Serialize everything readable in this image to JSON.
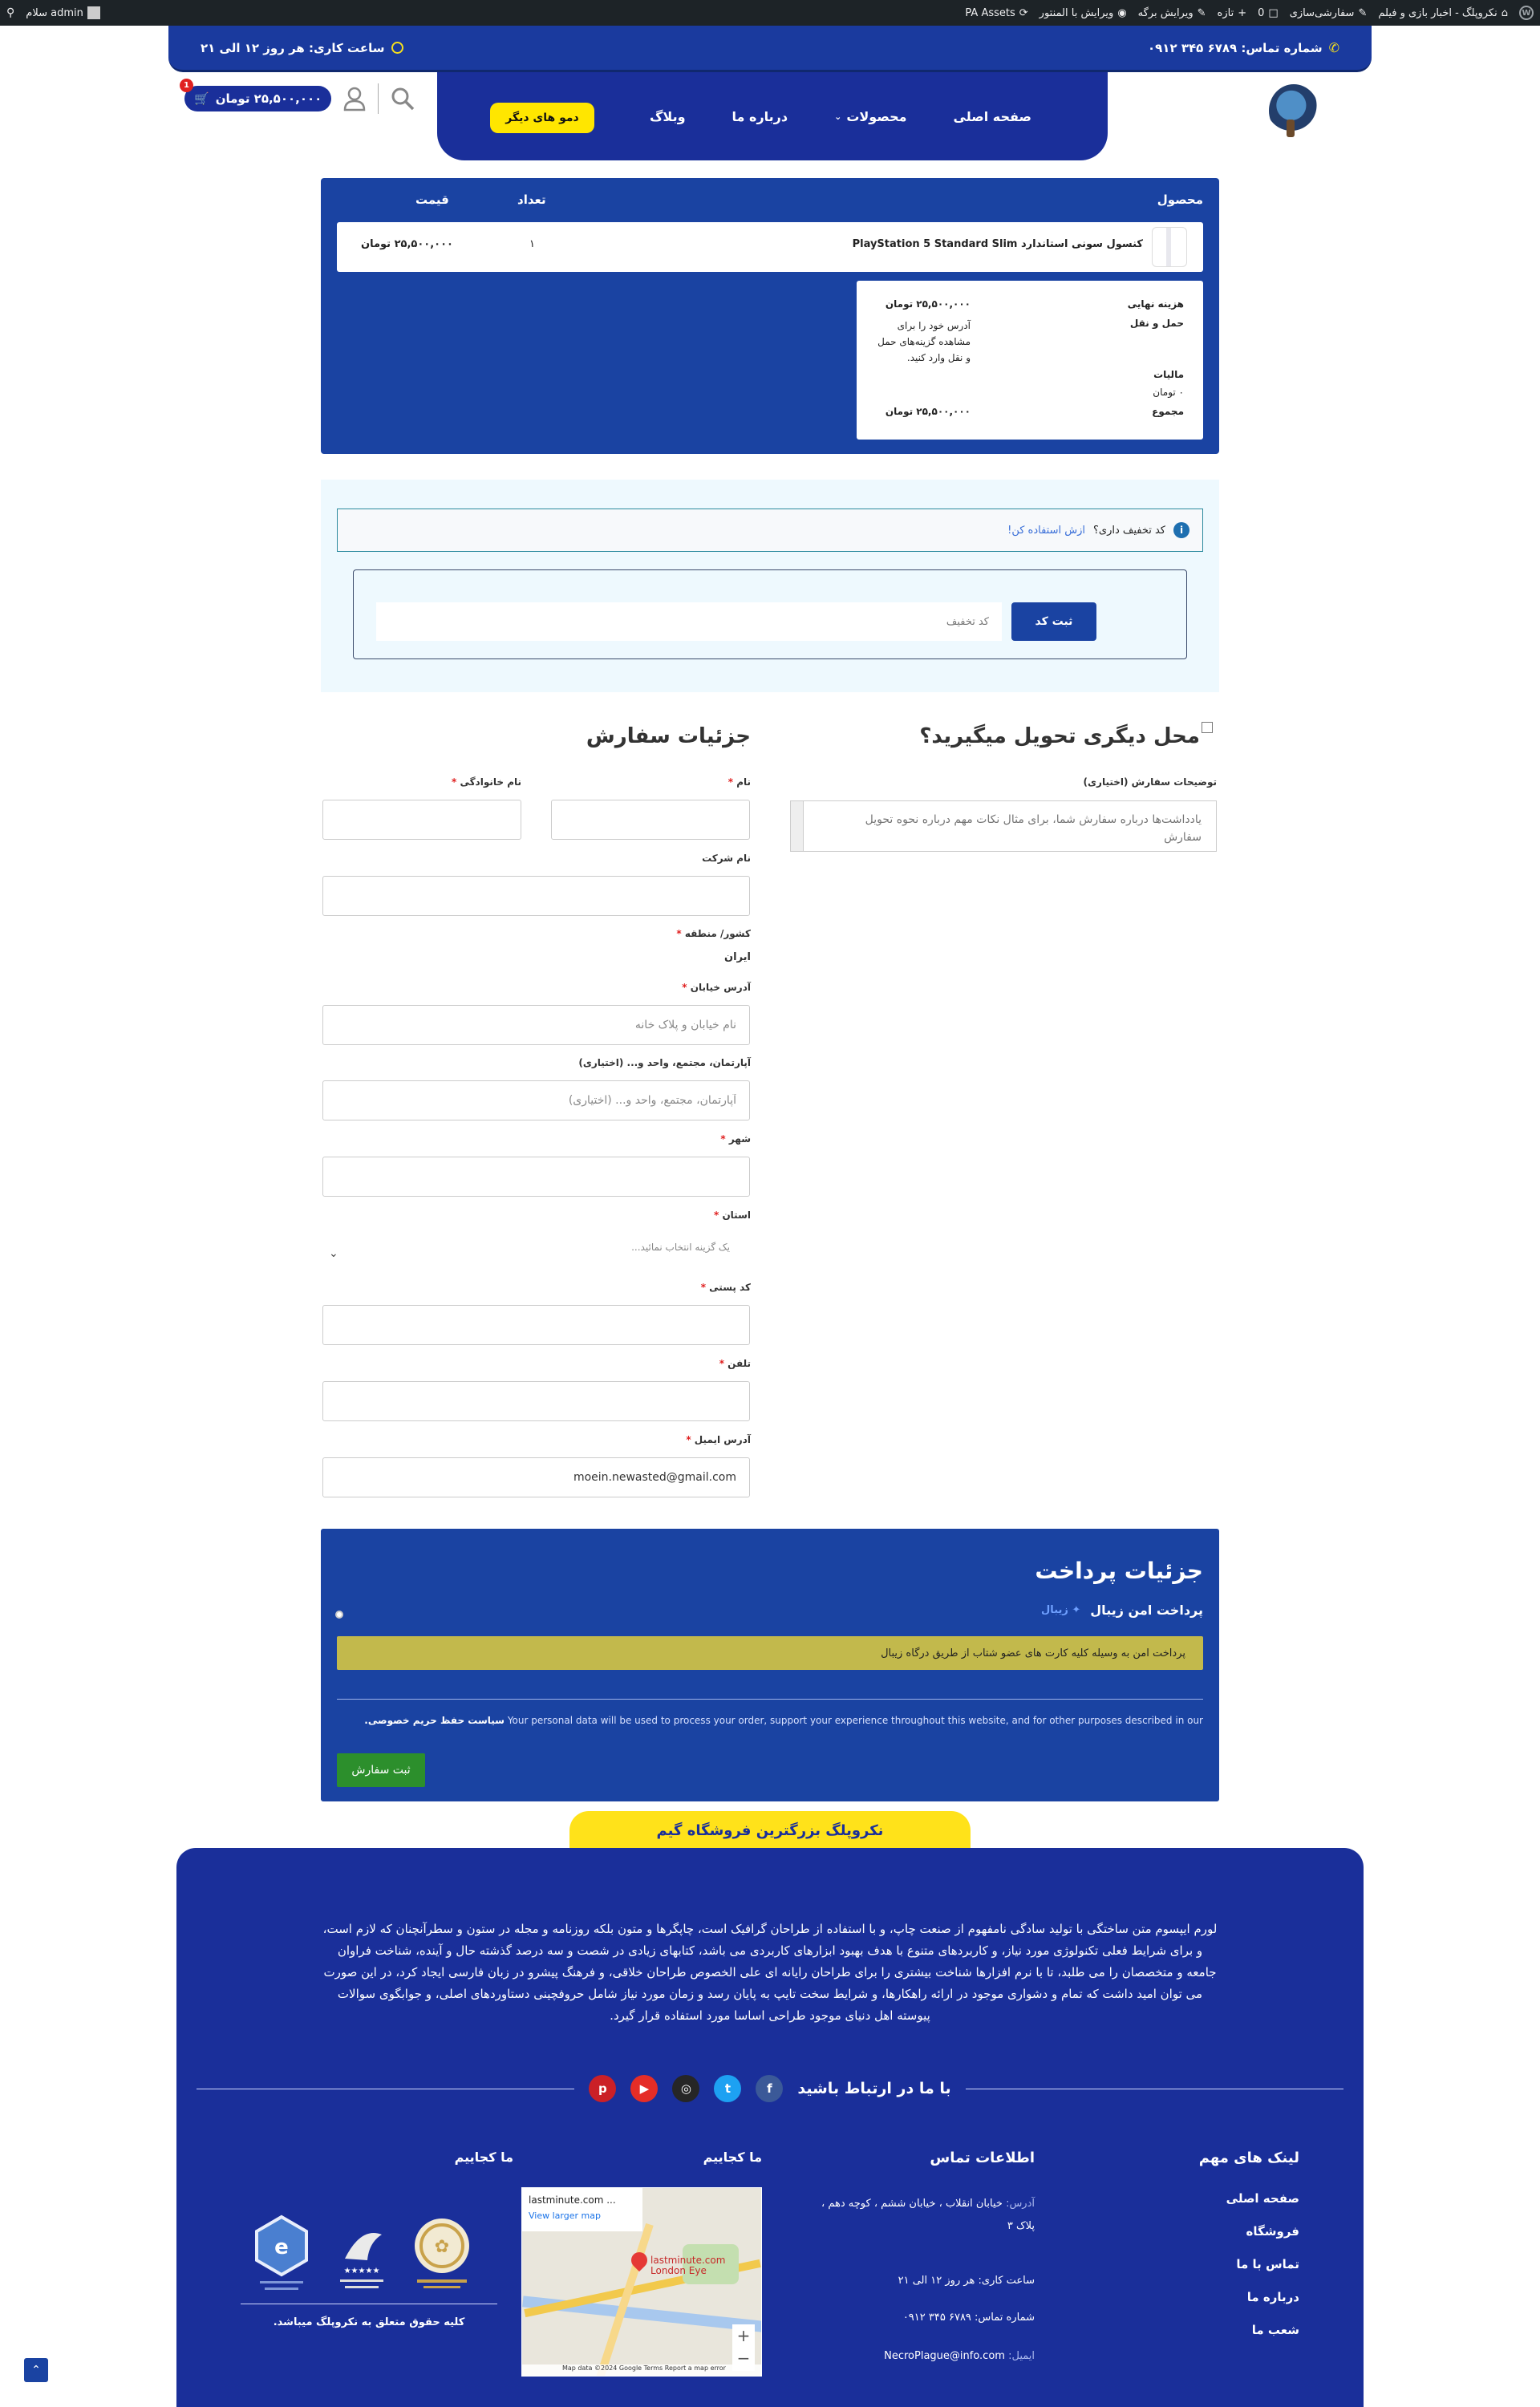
{
  "adminbar": {
    "site_name": "نکروپلگ - اخبار بازی و فیلم",
    "customize": "سفارشی‌سازی",
    "comments_count": "0",
    "new_label": "تازه",
    "edit_page": "ویرایش برگه",
    "edit_elementor": "ویرایش با المنتور",
    "pa_assets": "PA Assets",
    "greeting": "سلام admin"
  },
  "topbar": {
    "phone": "شماره تماس: ۶۷۸۹ ۳۴۵ ۰۹۱۲",
    "hours": "ساعت کاری: هر روز ۱۲ الی ۲۱"
  },
  "nav": {
    "home": "صفحه اصلی",
    "products": "محصولات",
    "about": "درباره ما",
    "blog": "وبلاگ",
    "demo_button": "دمو های دیگر"
  },
  "header_cart": {
    "total": "۲۵,۵۰۰,۰۰۰ تومان",
    "count": "1"
  },
  "cart": {
    "headers": {
      "product": "محصول",
      "quantity": "تعداد",
      "price": "قیمت"
    },
    "item": {
      "name": "کنسول سونی استاندارد PlayStation 5 Standard Slim",
      "quantity": "۱",
      "price": "۲۵,۵۰۰,۰۰۰ تومان"
    },
    "totals": {
      "final_label": "هزینه نهایی",
      "final_value": "۲۵,۵۰۰,۰۰۰ تومان",
      "shipping_label": "حمل و نقل",
      "shipping_value": "آدرس خود را برای مشاهده گزینه‌های حمل و نقل وارد کنید.",
      "tax_label": "مالیات",
      "tax_value": "۰ تومان",
      "sum_label": "مجموع",
      "sum_value": "۲۵,۵۰۰,۰۰۰ تومان"
    }
  },
  "coupon": {
    "question": "کد تخفیف داری؟",
    "link": "ازش استفاده کن!",
    "placeholder": "کد تخفیف",
    "button": "ثبت کد"
  },
  "billing": {
    "title": "جزئیات سفارش",
    "first_name_label": "نام",
    "last_name_label": "نام خانوادگی",
    "company_label": "نام شرکت",
    "country_label": "کشور/ منطقه",
    "country_value": "ایران",
    "street_label": "آدرس خیابان",
    "street_placeholder": "نام خیابان و پلاک خانه",
    "apartment_label": "آپارتمان، مجتمع، واحد و... (اختیاری)",
    "apartment_placeholder": "آپارتمان، مجتمع، واحد و... (اختیاری)",
    "city_label": "شهر",
    "state_label": "استان",
    "state_placeholder": "یک گزینه انتخاب نمائید...",
    "postcode_label": "کد پستی",
    "phone_label": "تلفن",
    "email_label": "آدرس ایمیل",
    "email_value": "moein.newasted@gmail.com",
    "required_mark": "*"
  },
  "shipping": {
    "title": "محل دیگری تحویل میگیرید؟",
    "notes_label": "توضیحات سفارش (اختیاری)",
    "notes_placeholder": "یادداشت‌ها درباره سفارش شما، برای مثال نکات مهم درباره نحوه تحویل سفارش"
  },
  "payment": {
    "title": "جزئیات پرداخت",
    "method": "پرداخت امن زیبال",
    "gateway_name": "زیبال",
    "description": "پرداخت امن به وسیله کلیه کارت های عضو شتاب از طریق درگاه زیبال",
    "privacy_text": "Your personal data will be used to process your order, support your experience throughout this website, and for other purposes described in our",
    "privacy_link": "سیاست حفظ حریم خصوصی.",
    "order_button": "ثبت سفارش"
  },
  "footer": {
    "tab": "نکروپلگ بزرگترین فروشگاه گیم",
    "text": "لورم ایپسوم متن ساختگی با تولید سادگی نامفهوم از صنعت چاپ، و با استفاده از طراحان گرافیک است، چاپگرها و متون بلکه روزنامه و مجله در ستون و سطرآنچنان که لازم است، و برای شرایط فعلی تکنولوژی مورد نیاز، و کاربردهای متنوع با هدف بهبود ابزارهای کاربردی می باشد، کتابهای زیادی در شصت و سه درصد گذشته حال و آینده، شناخت فراوان جامعه و متخصصان را می طلبد، تا با نرم افزارها شناخت بیشتری را برای طراحان رایانه ای علی الخصوص طراحان خلاقی، و فرهنگ پیشرو در زبان فارسی ایجاد کرد، در این صورت می توان امید داشت که تمام و دشواری موجود در ارائه راهکارها، و شرایط سخت تایپ به پایان رسد و زمان مورد نیاز شامل حروفچینی دستاوردهای اصلی، و جوابگوی سوالات پیوسته اهل دنیای موجود طراحی اساسا مورد استفاده قرار گیرد.",
    "contact_title": "با ما در ارتباط باشید",
    "social": [
      "facebook-icon",
      "twitter-icon",
      "instagram-icon",
      "youtube-icon",
      "pinterest-icon"
    ],
    "links_title": "لینک های مهم",
    "links": [
      "صفحه اصلی",
      "فروشگاه",
      "تماس با ما",
      "درباره ما",
      "شعب ما"
    ],
    "info_title": "اطلاعات تماس",
    "address_label": "آدرس:",
    "address": "خیابان انقلاب ، خیابان ششم ، کوچه دهم ، پلاک ۳",
    "hours": "ساعت کاری: هر روز ۱۲ الی ۲۱",
    "phone": "شماره تماس: ۶۷۸۹ ۳۴۵ ۰۹۱۲",
    "email_label": "ایمیل:",
    "email": "NecroPlague@info.com",
    "map_title": "ما کجاییم",
    "map_place": "lastminute.com ...",
    "map_link": "View larger map",
    "map_pin_label": "lastminute.com London Eye",
    "map_credit": "Map data ©2024 Google   Terms   Report a map error",
    "badges_title": "ما کجاییم",
    "copyright": "کلیه حقوق متعلق به نکروپلگ میباشد."
  },
  "colors": {
    "primary": "#1a43a2",
    "nav": "#1a2f9a",
    "accent": "#ffe600",
    "success": "#2c8f2c",
    "notice": "#c2b94c"
  }
}
